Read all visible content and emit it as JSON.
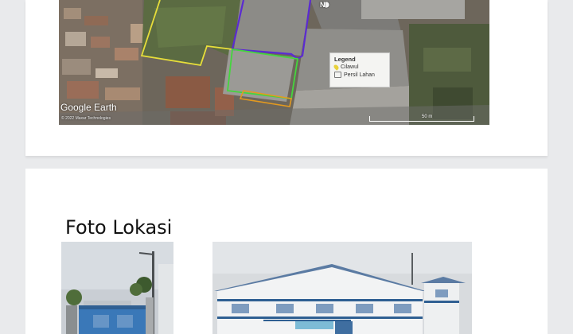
{
  "map": {
    "logo": "Google Earth",
    "credit": "© 2022 Maxar Technologies",
    "north_label": "N",
    "legend": {
      "title": "Legend",
      "items": [
        {
          "label": "Cilawul",
          "icon": "pin-icon"
        },
        {
          "label": "Persil Lahan",
          "icon": "polygon-icon"
        }
      ]
    },
    "scale_label": "50 m"
  },
  "watermark": "",
  "section": {
    "title": "Foto Lokasi"
  },
  "colors": {
    "yellow_boundary": "#e7de3a",
    "purple_boundary": "#5b2bd1",
    "green_boundary": "#44d63d",
    "orange_boundary": "#e49a1f"
  }
}
